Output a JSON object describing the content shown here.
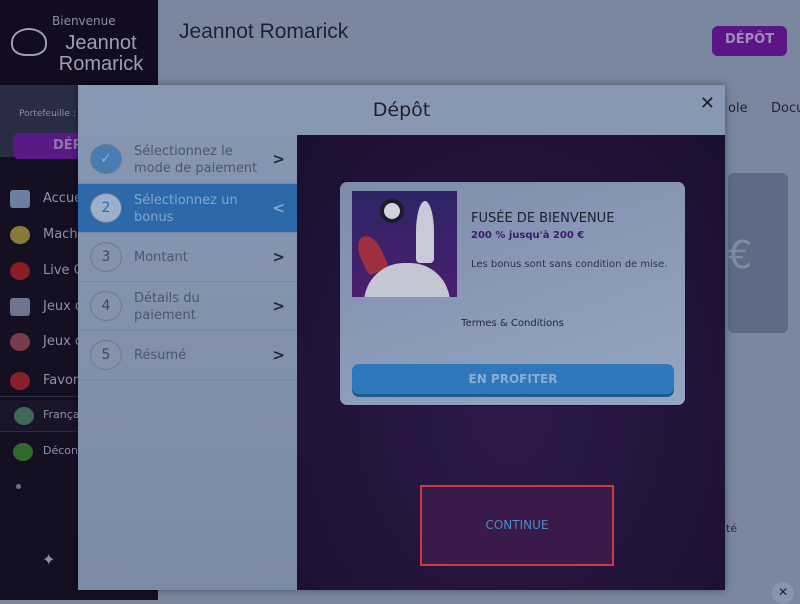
{
  "sidebar": {
    "welcome": "Bienvenue",
    "user_name": "Jeannot Romarick",
    "wallet_label": "Portefeuille :",
    "deposit_label": "DÉPÔT",
    "items": [
      {
        "label": "Accueil",
        "icon": "satellite-icon"
      },
      {
        "label": "Machines à sous",
        "icon": "slot-machine-icon"
      },
      {
        "label": "Live Casino",
        "icon": "roulette-icon"
      },
      {
        "label": "Jeux de table",
        "icon": "cards-icon"
      },
      {
        "label": "Jeux de crash",
        "icon": "rocket-icon"
      },
      {
        "label": "Favoris",
        "icon": "heart-icon"
      },
      {
        "label": "Français",
        "icon": "globe-icon"
      },
      {
        "label": "Déconnexion",
        "icon": "alien-icon"
      }
    ]
  },
  "header": {
    "title": "Jeannot Romarick",
    "deposit_label": "DÉPÔT",
    "tabs": [
      "ole",
      "Docu"
    ],
    "bg_card_symbol": "€",
    "bg_text": "té"
  },
  "modal": {
    "title": "Dépôt",
    "close": "✕",
    "steps": [
      {
        "num": "✓",
        "label": "Sélectionnez le mode de paiement",
        "state": "done"
      },
      {
        "num": "2",
        "label": "Sélectionnez un bonus",
        "state": "active"
      },
      {
        "num": "3",
        "label": "Montant",
        "state": "pending"
      },
      {
        "num": "4",
        "label": "Détails du paiement",
        "state": "pending"
      },
      {
        "num": "5",
        "label": "Résumé",
        "state": "pending"
      }
    ],
    "bonus": {
      "title": "FUSÉE DE BIENVENUE",
      "subtitle": "200 % jusqu'à 200 €",
      "description": "Les bonus sont sans condition de mise.",
      "terms": "Termes & Conditions",
      "claim_label": "EN PROFITER"
    },
    "continue_label": "CONTINUE"
  },
  "colors": {
    "accent_purple": "#5c1487",
    "step_active": "#2d69a8",
    "highlight_border": "#cc3b3b"
  }
}
